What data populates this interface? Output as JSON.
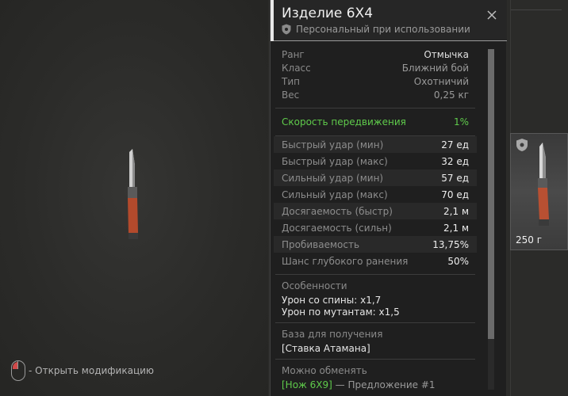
{
  "hint": {
    "text": "- Открыть модификацию"
  },
  "item": {
    "name": "Изделие 6Х4",
    "binding": "Персональный при использовании",
    "base": [
      {
        "label": "Ранг",
        "value": "Отмычка",
        "highlight": true
      },
      {
        "label": "Класс",
        "value": "Ближний бой",
        "highlight": false
      },
      {
        "label": "Тип",
        "value": "Охотничий",
        "highlight": false
      },
      {
        "label": "Вес",
        "value": "0,25 кг",
        "highlight": false
      }
    ],
    "speed": {
      "label": "Скорость передвижения",
      "value": "1%"
    },
    "stats": [
      {
        "label": "Быстрый удар (мин)",
        "value": "27 ед"
      },
      {
        "label": "Быстрый удар (макс)",
        "value": "32 ед"
      },
      {
        "label": "Сильный удар (мин)",
        "value": "57 ед"
      },
      {
        "label": "Сильный удар (макс)",
        "value": "70 ед"
      },
      {
        "label": "Досягаемость (быстр)",
        "value": "2,1 м"
      },
      {
        "label": "Досягаемость (сильн)",
        "value": "2,1 м"
      },
      {
        "label": "Пробиваемость",
        "value": "13,75%"
      },
      {
        "label": "Шанс глубокого ранения",
        "value": "50%"
      }
    ],
    "features": {
      "title": "Особенности",
      "lines": [
        "Урон со спины: x1,7",
        "Урон по мутантам: x1,5"
      ]
    },
    "source": {
      "title": "База для получения",
      "value": "[Ставка Атамана]"
    },
    "exchange": {
      "title": "Можно обменять",
      "item": "[Нож 6Х9]",
      "rest": " — Предложение #1"
    }
  },
  "card": {
    "weight": "250 г"
  },
  "icons": {
    "shield": "shield-icon",
    "close": "close-icon",
    "mouse": "mouse-icon"
  },
  "colors": {
    "green": "#5fcb4b",
    "panel": "#1f1f1f"
  }
}
